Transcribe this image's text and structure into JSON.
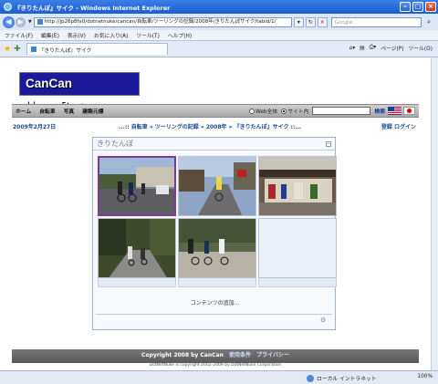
{
  "window": {
    "title": "『きりたんぽ』サイク - Windows Internet Explorer"
  },
  "address": {
    "url": "http://jp26p8fx0/dotnetnuke/cancan/自転車/ツーリングの記録/2008年/きりたんぽサイク/tabid/1/",
    "search_placeholder": "Google"
  },
  "menu": {
    "items": [
      "ファイル(F)",
      "編集(E)",
      "表示(V)",
      "お気に入り(A)",
      "ツール(T)",
      "ヘルプ(H)"
    ]
  },
  "tab": {
    "label": "『きりたんぽ』サイク"
  },
  "toolbar": {
    "page_label": "ページ(P)",
    "tools_label": "ツール(O)"
  },
  "site": {
    "logo_text": "CanCan HomePage",
    "nav": [
      "ホーム",
      "自転車",
      "写真",
      "建築元標"
    ],
    "search_web": "Web全体",
    "search_site": "サイト内",
    "search_button": "検索"
  },
  "breadcrumb": {
    "date": "2009年2月27日",
    "path": "...:: 自転車 » ツーリングの記録 » 2008年 » 『きりたんぽ』サイク ::...",
    "register": "登録",
    "login": "ログイン"
  },
  "module": {
    "title": "きりたんぽ",
    "add_content": "コンテンツの追加..."
  },
  "footer": {
    "copyright": "Copyright 2008 by CanCan",
    "terms": "使用条件",
    "privacy": "プライバシー",
    "powered": "DotNetNuke is copyright 2002-2009 by DotNetNuke Corporation"
  },
  "status": {
    "zone": "ローカル イントラネット",
    "zoom": "100%"
  },
  "colors": {
    "logo_bg": "#1a1a9a",
    "selected_border": "#7b3a9a"
  }
}
